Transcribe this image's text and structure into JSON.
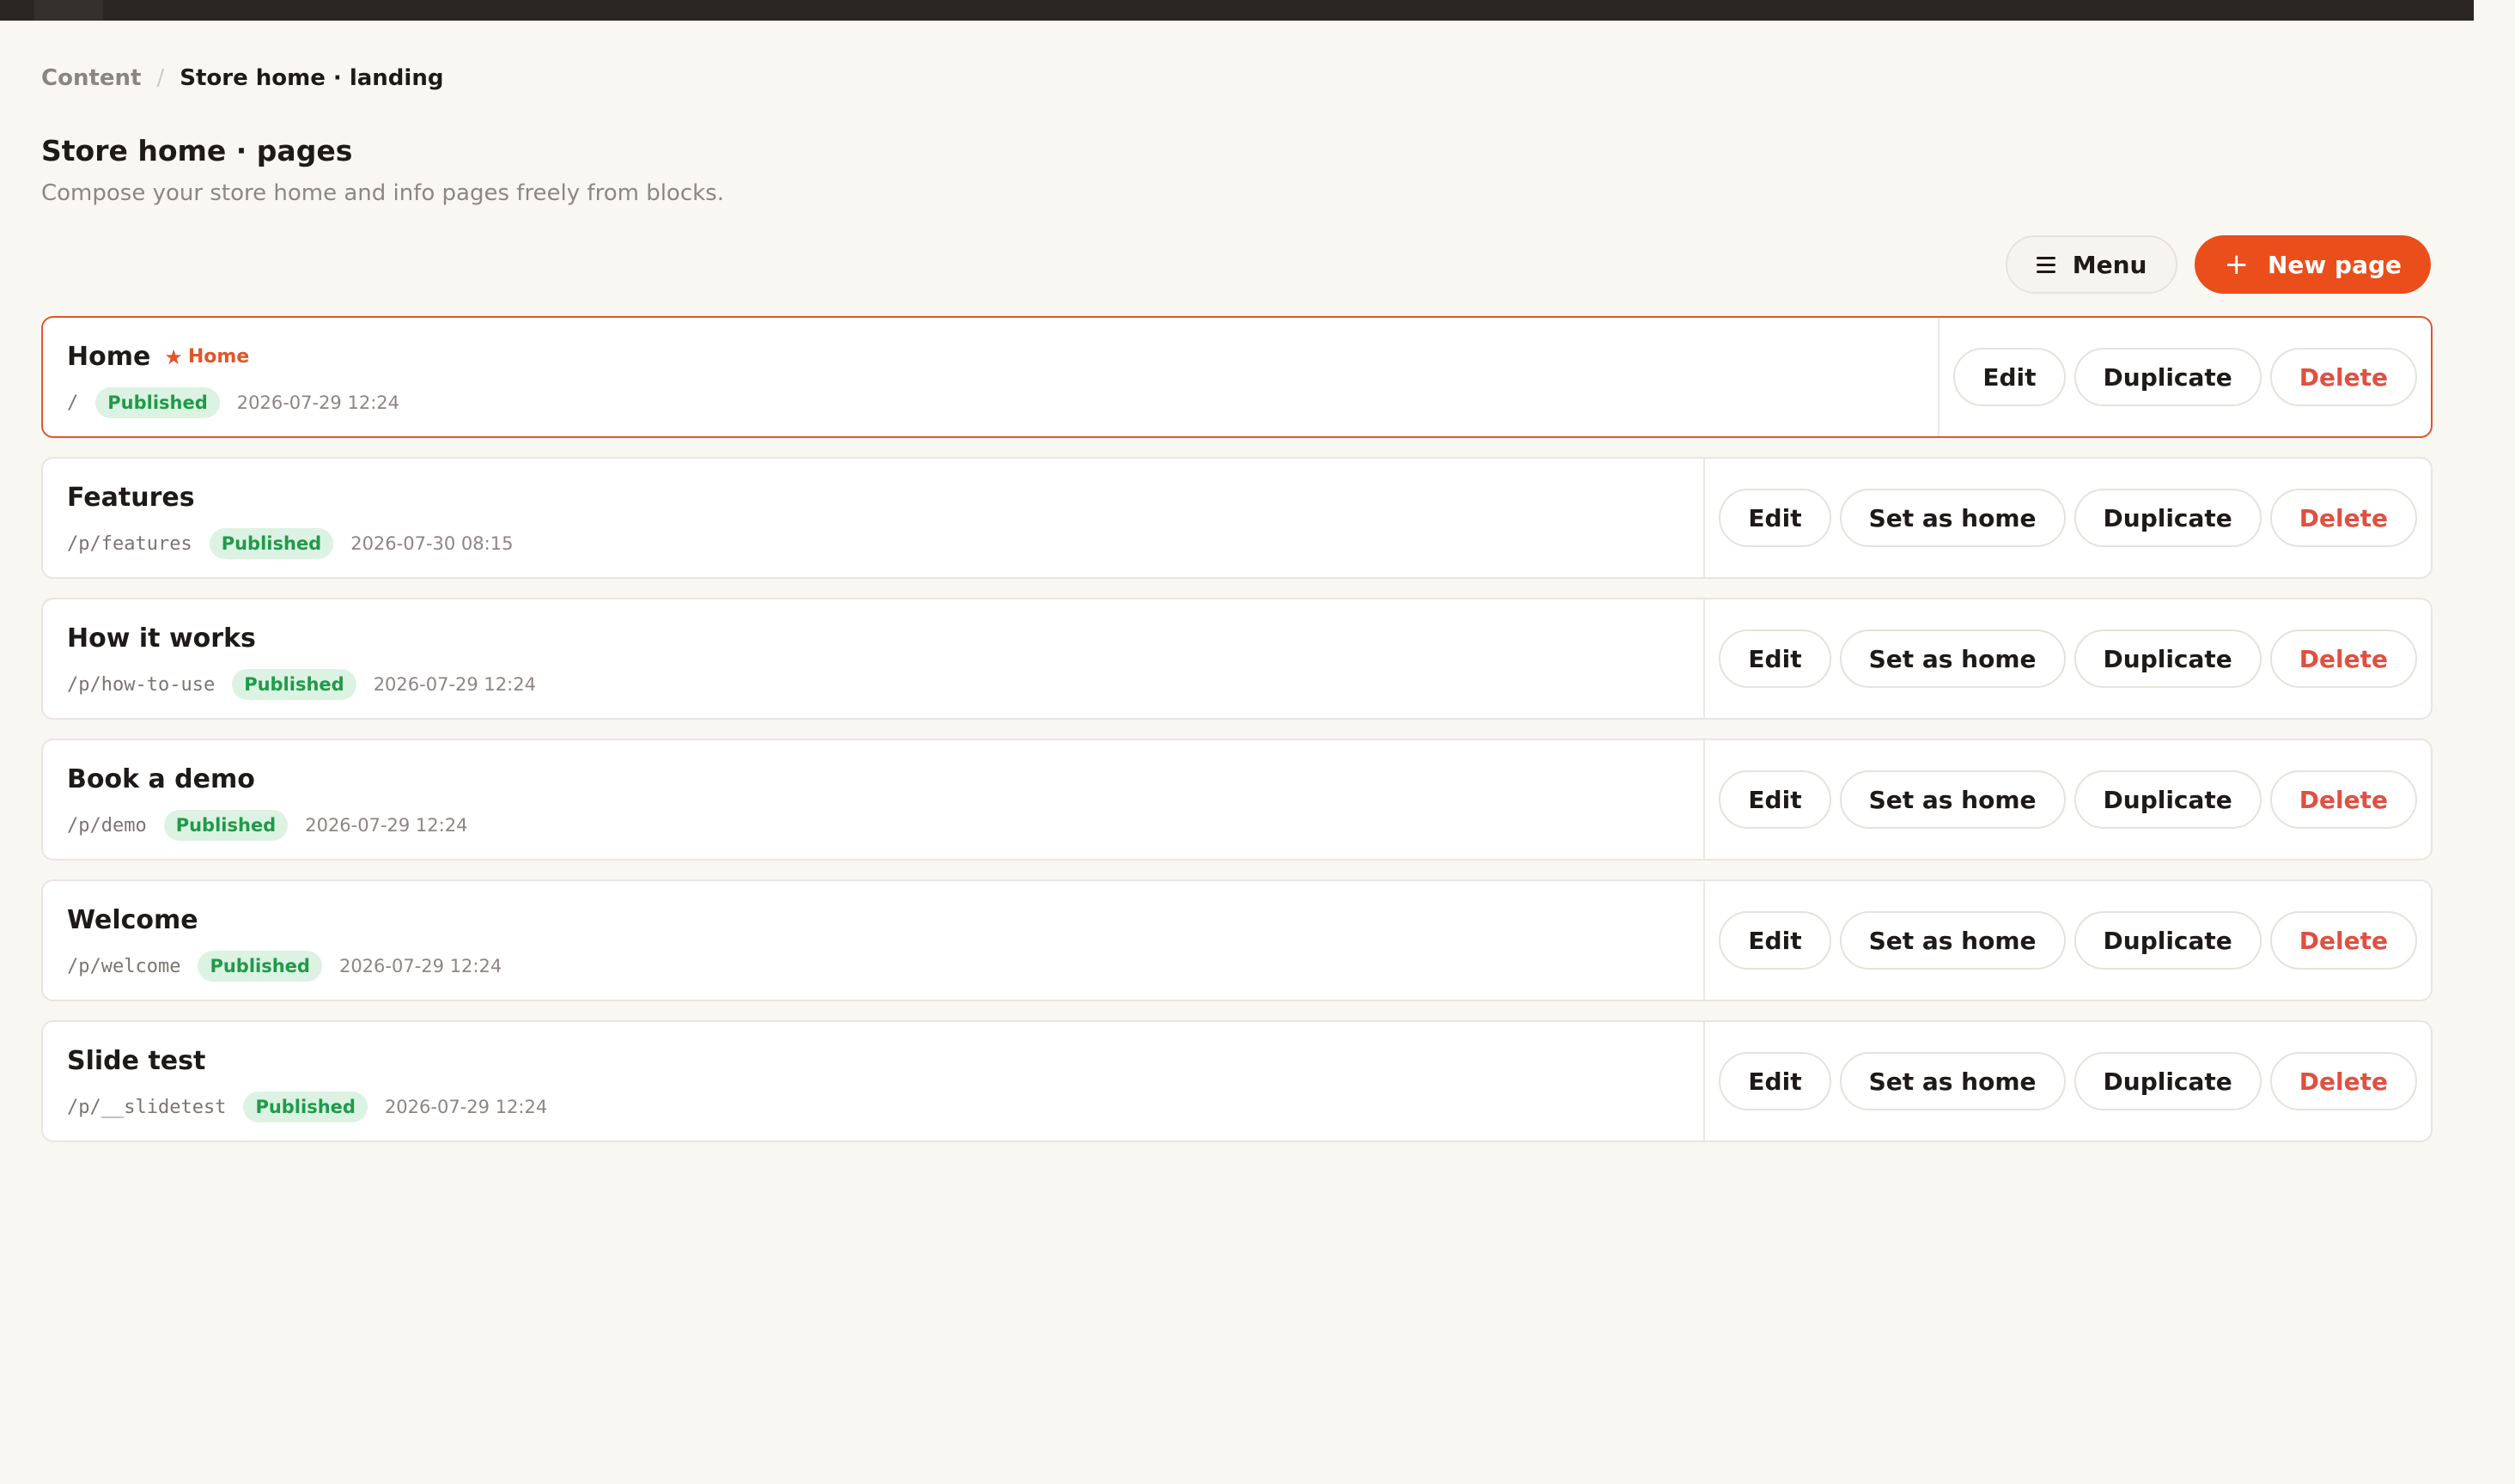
{
  "breadcrumb": {
    "parent": "Content",
    "separator": "/",
    "current": "Store home · landing"
  },
  "header": {
    "title": "Store home · pages",
    "subtitle": "Compose your store home and info pages freely from blocks."
  },
  "toolbar": {
    "menu_label": "Menu",
    "new_page_label": "New page"
  },
  "colors": {
    "accent": "#ea4e1b",
    "published_bg": "#dcf2e2",
    "published_text": "#1f9a4a",
    "danger": "#e05040"
  },
  "actions": {
    "edit": "Edit",
    "set_home": "Set as home",
    "duplicate": "Duplicate",
    "delete": "Delete"
  },
  "home_tag_label": "Home",
  "pages": [
    {
      "title": "Home",
      "path": "/",
      "status": "Published",
      "updated": "2026-07-29 12:24",
      "is_home": true
    },
    {
      "title": "Features",
      "path": "/p/features",
      "status": "Published",
      "updated": "2026-07-30 08:15",
      "is_home": false
    },
    {
      "title": "How it works",
      "path": "/p/how-to-use",
      "status": "Published",
      "updated": "2026-07-29 12:24",
      "is_home": false
    },
    {
      "title": "Book a demo",
      "path": "/p/demo",
      "status": "Published",
      "updated": "2026-07-29 12:24",
      "is_home": false
    },
    {
      "title": "Welcome",
      "path": "/p/welcome",
      "status": "Published",
      "updated": "2026-07-29 12:24",
      "is_home": false
    },
    {
      "title": "Slide test",
      "path": "/p/__slidetest",
      "status": "Published",
      "updated": "2026-07-29 12:24",
      "is_home": false
    }
  ]
}
